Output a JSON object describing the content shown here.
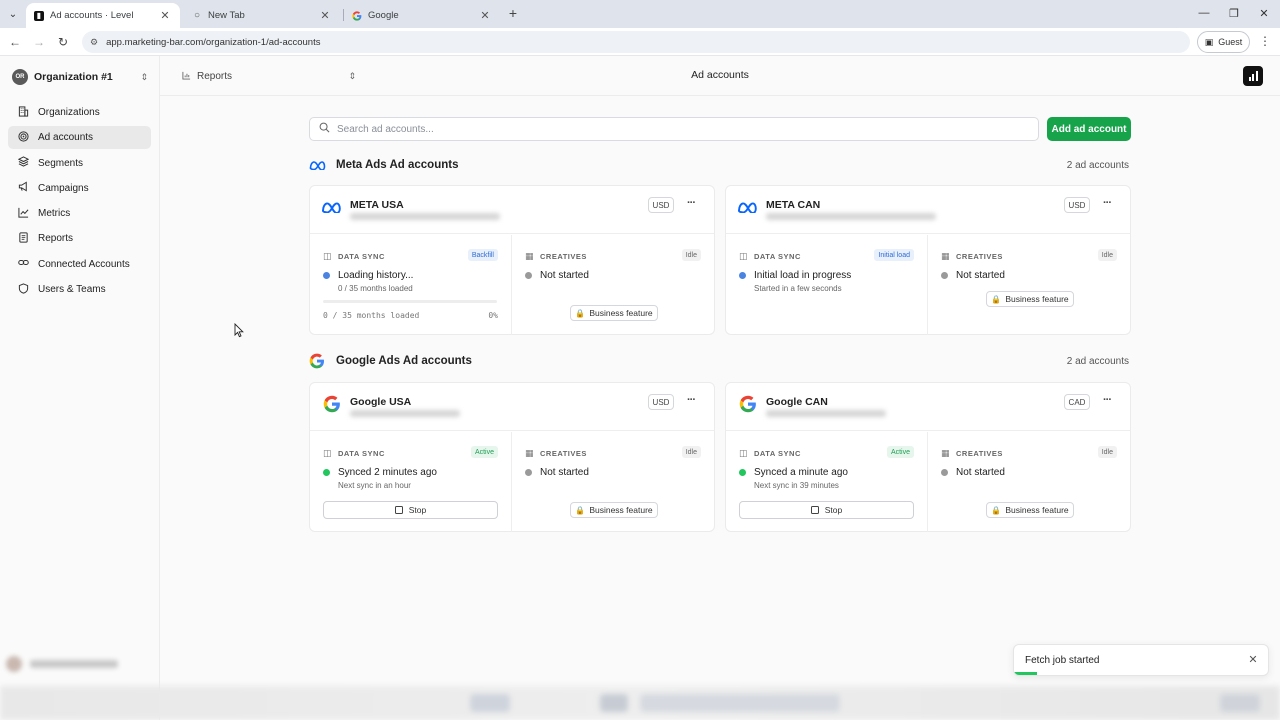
{
  "browser": {
    "tabs": [
      {
        "title": "Ad accounts · Level",
        "active": true
      },
      {
        "title": "New Tab",
        "active": false
      },
      {
        "title": "Google",
        "active": false
      }
    ],
    "url": "app.marketing-bar.com/organization-1/ad-accounts",
    "profile_label": "Guest"
  },
  "sidebar": {
    "org_initials": "OR",
    "org_name": "Organization #1",
    "items": [
      {
        "label": "Organizations",
        "icon": "building-icon",
        "active": false
      },
      {
        "label": "Ad accounts",
        "icon": "target-icon",
        "active": true
      },
      {
        "label": "Segments",
        "icon": "layers-icon",
        "active": false
      },
      {
        "label": "Campaigns",
        "icon": "megaphone-icon",
        "active": false
      },
      {
        "label": "Metrics",
        "icon": "line-chart-icon",
        "active": false
      },
      {
        "label": "Reports",
        "icon": "document-icon",
        "active": false
      },
      {
        "label": "Connected Accounts",
        "icon": "link-icon",
        "active": false
      },
      {
        "label": "Users & Teams",
        "icon": "shield-icon",
        "active": false
      }
    ]
  },
  "topbar": {
    "reports_select": "Reports",
    "page_title": "Ad accounts"
  },
  "main": {
    "search_placeholder": "Search ad accounts...",
    "add_button": "Add ad account",
    "sections": [
      {
        "title": "Meta Ads Ad accounts",
        "count": "2 ad accounts",
        "accounts": [
          {
            "name": "META USA",
            "currency": "USD",
            "sync_label": "DATA SYNC",
            "sync_badge": "Backfill",
            "sync_badge_color": "#2f6bd8",
            "sync_status": "Loading history...",
            "sync_sub": "0 / 35 months loaded",
            "progress_text": "0 / 35 months loaded",
            "progress_pct": "0%",
            "progress": 0,
            "creatives_label": "CREATIVES",
            "creatives_badge": "Idle",
            "creatives_status": "Not started",
            "business_label": "Business feature"
          },
          {
            "name": "META CAN",
            "currency": "USD",
            "sync_label": "DATA SYNC",
            "sync_badge": "Initial load",
            "sync_badge_color": "#2f6bd8",
            "sync_status": "Initial load in progress",
            "sync_sub": "Started in a few seconds",
            "creatives_label": "CREATIVES",
            "creatives_badge": "Idle",
            "creatives_status": "Not started",
            "business_label": "Business feature"
          }
        ]
      },
      {
        "title": "Google Ads Ad accounts",
        "count": "2 ad accounts",
        "accounts": [
          {
            "name": "Google USA",
            "currency": "USD",
            "sync_label": "DATA SYNC",
            "sync_badge": "Active",
            "sync_badge_color": "#1f9d55",
            "sync_status": "Synced 2 minutes ago",
            "sync_sub": "Next sync in an hour",
            "stop_label": "Stop",
            "creatives_label": "CREATIVES",
            "creatives_badge": "Idle",
            "creatives_status": "Not started",
            "business_label": "Business feature"
          },
          {
            "name": "Google CAN",
            "currency": "CAD",
            "sync_label": "DATA SYNC",
            "sync_badge": "Active",
            "sync_badge_color": "#1f9d55",
            "sync_status": "Synced a minute ago",
            "sync_sub": "Next sync in 39 minutes",
            "stop_label": "Stop",
            "creatives_label": "CREATIVES",
            "creatives_badge": "Idle",
            "creatives_status": "Not started",
            "business_label": "Business feature"
          }
        ]
      }
    ]
  },
  "toast": {
    "message": "Fetch job started",
    "progress": 0.09
  },
  "colors": {
    "accent_green": "#16a34a",
    "status_blue": "#4a83e0",
    "status_green": "#22c55e",
    "meta_blue": "#0866ff"
  }
}
